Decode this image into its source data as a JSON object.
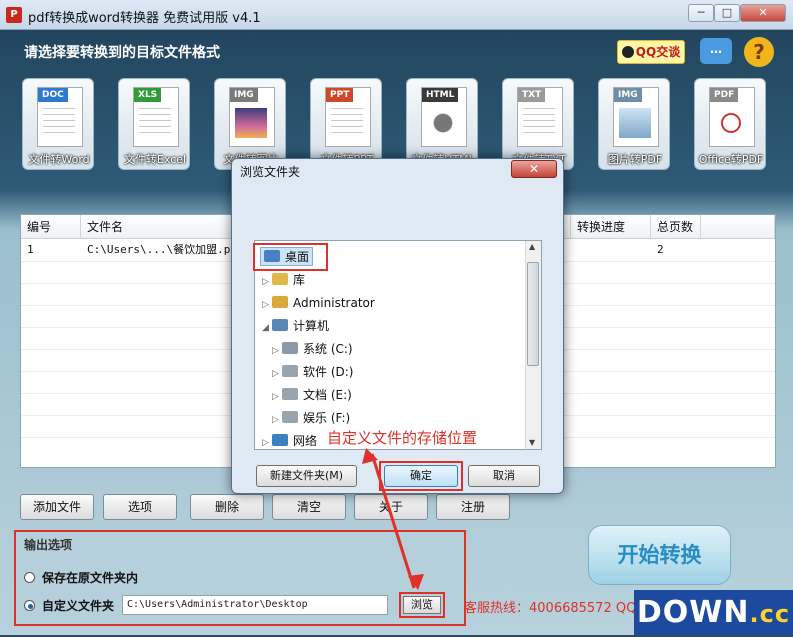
{
  "window": {
    "title": "pdf转换成word转换器 免费试用版 v4.1",
    "min": "─",
    "max": "□",
    "close": "✕"
  },
  "header": {
    "heading": "请选择要转换到的目标文件格式",
    "qq_label": "QQ交谈",
    "chat_icon": "…",
    "help_icon": "?"
  },
  "formats": [
    {
      "tag": "DOC",
      "label": "文件转Word",
      "color": "#2f7ad1"
    },
    {
      "tag": "XLS",
      "label": "文件转Excel",
      "color": "#2f9b3b"
    },
    {
      "tag": "IMG",
      "label": "文件转图片",
      "color": "#7a7a7a"
    },
    {
      "tag": "PPT",
      "label": "文件转PPT",
      "color": "#d0482b"
    },
    {
      "tag": "HTML",
      "label": "文件转HTML",
      "color": "#3a3a3a"
    },
    {
      "tag": "TXT",
      "label": "文件转TXT",
      "color": "#9a9a9a"
    },
    {
      "tag": "IMG",
      "label": "图片转PDF",
      "color": "#6f8ea7"
    },
    {
      "tag": "PDF",
      "label": "Office转PDF",
      "color": "#8a8a8a"
    }
  ],
  "table": {
    "headers": [
      "编号",
      "文件名",
      "转换进度",
      "总页数"
    ],
    "rows": [
      {
        "id": "1",
        "filename": "C:\\Users\\...\\餐饮加盟.pd",
        "progress": "",
        "pages": "2"
      }
    ]
  },
  "buttons": {
    "add_file": "添加文件",
    "options": "选项",
    "delete": "删除",
    "clear": "清空",
    "about": "关于",
    "register": "注册"
  },
  "output": {
    "title": "输出选项",
    "option_original": "保存在原文件夹内",
    "option_custom": "自定义文件夹",
    "path": "C:\\Users\\Administrator\\Desktop",
    "browse": "浏览",
    "hotline": "客服热线：4006685572 QQ"
  },
  "start_button": "开始转换",
  "watermark": {
    "main": "DOWN",
    "suffix": ".cc"
  },
  "dialog": {
    "title": "浏览文件夹",
    "close": "✕",
    "tree": [
      {
        "label": "桌面",
        "indent": 0,
        "arrow": "",
        "icon": "#4a7fc4"
      },
      {
        "label": "库",
        "indent": 0,
        "arrow": "▷",
        "icon": "#e0b84a"
      },
      {
        "label": "Administrator",
        "indent": 0,
        "arrow": "▷",
        "icon": "#d9a73a"
      },
      {
        "label": "计算机",
        "indent": 0,
        "arrow": "◢",
        "icon": "#5a86b6"
      },
      {
        "label": "系统 (C:)",
        "indent": 1,
        "arrow": "▷",
        "icon": "#8a9aa8"
      },
      {
        "label": "软件 (D:)",
        "indent": 1,
        "arrow": "▷",
        "icon": "#9aa4ad"
      },
      {
        "label": "文档 (E:)",
        "indent": 1,
        "arrow": "▷",
        "icon": "#9aa4ad"
      },
      {
        "label": "娱乐 (F:)",
        "indent": 1,
        "arrow": "▷",
        "icon": "#9aa4ad"
      },
      {
        "label": "网络",
        "indent": 0,
        "arrow": "▷",
        "icon": "#3c7fc1"
      }
    ],
    "annotation": "自定义文件的存储位置",
    "new_folder": "新建文件夹(M)",
    "ok": "确定",
    "cancel": "取消"
  }
}
